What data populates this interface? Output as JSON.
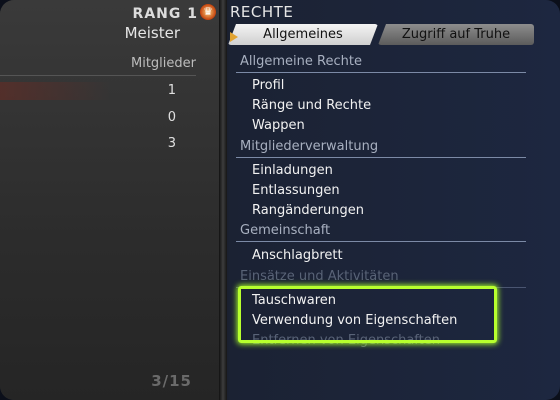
{
  "left_panel": {
    "rank_label": "RANG 1",
    "rank_icon": "rank-crest-icon",
    "rank_title": "Meister",
    "column_header": "Mitglieder",
    "counts": [
      "1",
      "0",
      "3"
    ],
    "page_indicator": "3/15"
  },
  "right_panel": {
    "title": "RECHTE",
    "tabs": [
      {
        "label": "Allgemeines",
        "active": true
      },
      {
        "label": "Zugriff auf Truhe",
        "active": false
      }
    ],
    "sections": [
      {
        "label": "Allgemeine Rechte",
        "items": [
          "Profil",
          "Ränge und Rechte",
          "Wappen"
        ]
      },
      {
        "label": "Mitgliederverwaltung",
        "items": [
          "Einladungen",
          "Entlassungen",
          "Rangänderungen"
        ]
      },
      {
        "label": "Gemeinschaft",
        "items": [
          "Anschlagbrett"
        ]
      },
      {
        "label": "Einsätze und Aktivitäten",
        "items": [
          "Tauschwaren",
          "Verwendung von Eigenschaften",
          "Entfernen von Eigenschaften"
        ]
      }
    ]
  },
  "colors": {
    "focus_highlight": "#b7ff2e",
    "active_tab": "#f4f4f4",
    "rank_icon": "#c2410c"
  }
}
